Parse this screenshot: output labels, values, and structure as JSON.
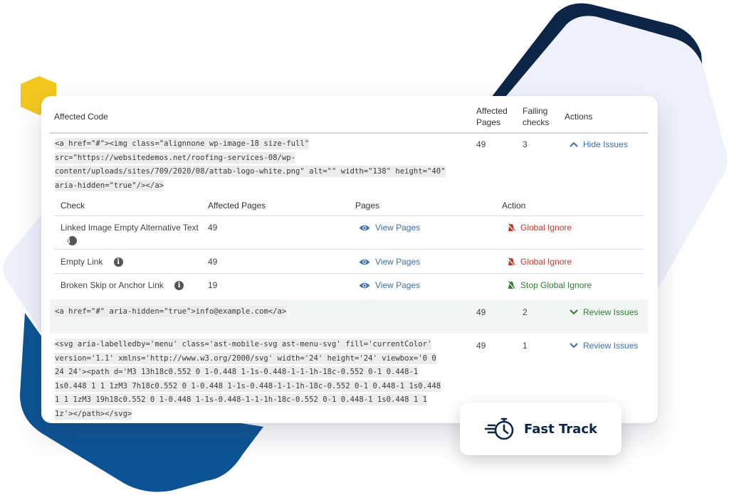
{
  "colors": {
    "navy": "#0d2547",
    "blue_shape": "#0b5394",
    "yellow": "#f2c81f",
    "lavender": "#eef0fb",
    "link_blue": "#3b6fb0",
    "ignore_red": "#c0392b",
    "stop_green": "#2e7d32"
  },
  "table": {
    "headers": {
      "code": "Affected Code",
      "pages_l1": "Affected",
      "pages_l2": "Pages",
      "fail_l1": "Failing",
      "fail_l2": "checks",
      "actions": "Actions"
    },
    "rows": [
      {
        "code_lines": [
          " <a href=\"#\"><img class=\"alignnone wp-image-18 size-full\"",
          "src=\"https://websitedemos.net/roofing-services-08/wp-",
          "content/uploads/sites/709/2020/08/attab-logo-white.png\" alt=\"\" width=\"138\" height=\"40\"",
          "aria-hidden=\"true\"/></a>"
        ],
        "affected_pages": "49",
        "failing_checks": "3",
        "action_label": "Hide Issues",
        "action_icon": "chevron-up-icon"
      },
      {
        "code_lines": [
          " <a href=\"#\" aria-hidden=\"true\">info@example.com</a>"
        ],
        "affected_pages": "49",
        "failing_checks": "2",
        "action_label": "Review Issues",
        "action_icon": "chevron-down-icon"
      },
      {
        "code_lines": [
          " <svg aria-labelledby='menu' class='ast-mobile-svg ast-menu-svg' fill='currentColor'",
          "version='1.1' xmlns='http://www.w3.org/2000/svg' width='24' height='24' viewbox='0 0",
          "24 24'><path d='M3 13h18c0.552 0 1-0.448 1-1s-0.448-1-1-1h-18c-0.552 0-1 0.448-1",
          "1s0.448 1 1 1zM3 7h18c0.552 0 1-0.448 1-1s-0.448-1-1-1h-18c-0.552 0-1 0.448-1 1s0.448",
          "1 1 1zM3 19h18c0.552 0 1-0.448 1-1s-0.448-1-1-1h-18c-0.552 0-1 0.448-1 1s0.448 1 1",
          "1z'></path></svg>"
        ],
        "affected_pages": "49",
        "failing_checks": "1",
        "action_label": "Review Issues",
        "action_icon": "chevron-down-icon"
      }
    ]
  },
  "subtable": {
    "headers": {
      "check": "Check",
      "affected_pages": "Affected Pages",
      "pages": "Pages",
      "action": "Action"
    },
    "rows": [
      {
        "check": "Linked Image Empty Alternative Text",
        "affected_pages": "49",
        "pages_link": "View Pages",
        "action": "Global Ignore",
        "action_state": "ignore"
      },
      {
        "check": "Empty Link",
        "affected_pages": "49",
        "pages_link": "View Pages",
        "action": "Global Ignore",
        "action_state": "ignore"
      },
      {
        "check": "Broken Skip or Anchor Link",
        "affected_pages": "19",
        "pages_link": "View Pages",
        "action": "Stop Global Ignore",
        "action_state": "stop"
      }
    ]
  },
  "badge": {
    "label": "Fast Track",
    "icon": "stopwatch-icon"
  }
}
